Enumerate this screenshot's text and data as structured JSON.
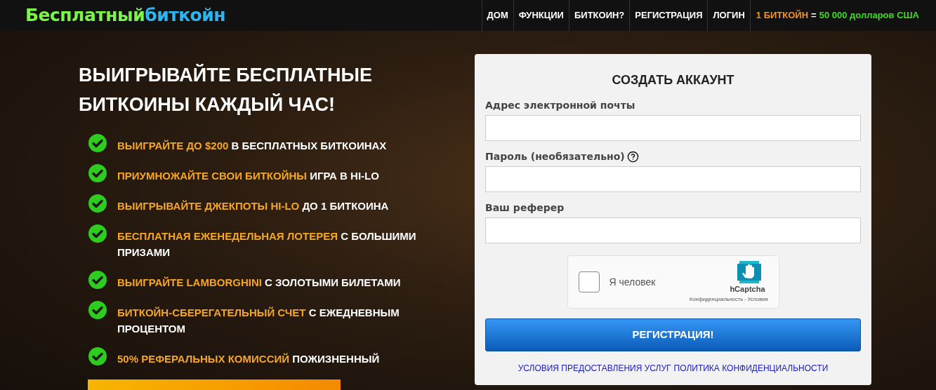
{
  "logo": {
    "part_1": "Бесплатный",
    "part_2": "биткойн"
  },
  "nav": {
    "items": [
      {
        "label": "ДОМ"
      },
      {
        "label": "ФУНКЦИИ"
      },
      {
        "label": "БИТКОИН?"
      },
      {
        "label": "РЕГИСТРАЦИЯ"
      },
      {
        "label": "ЛОГИН"
      }
    ],
    "price": {
      "unit": "1 БИТКОЙН",
      "equals": "=",
      "value": "50 000 долларов США"
    }
  },
  "hero": {
    "headline": "ВЫИГРЫВАЙТЕ БЕСПЛАТНЫЕ БИТКОИНЫ КАЖДЫЙ ЧАС!",
    "features": [
      {
        "highlight": "ВЫИГРАЙТЕ ДО $200",
        "text": "В БЕСПЛАТНЫХ БИТКОИНАХ"
      },
      {
        "highlight": "ПРИУМНОЖАЙТЕ СВОИ БИТКОЙНЫ",
        "text": "ИГРА В HI-LO"
      },
      {
        "highlight": "ВЫИГРЫВАЙТЕ ДЖЕКПОТЫ HI-LO",
        "text": "ДО 1 БИТКОИНА"
      },
      {
        "highlight": "БЕСПЛАТНАЯ ЕЖЕНЕДЕЛЬНАЯ ЛОТЕРЕЯ",
        "text": "С БОЛЬШИМИ ПРИЗАМИ"
      },
      {
        "highlight": "ВЫИГРАЙТЕ LAMBORGHINI",
        "text": "С ЗОЛОТЫМИ БИЛЕТАМИ"
      },
      {
        "highlight": "БИТКОЙН-СБЕРЕГАТЕЛЬНЫЙ СЧЕТ",
        "text": "С ЕЖЕДНЕВНЫМ ПРОЦЕНТОМ"
      },
      {
        "highlight": "50% РЕФЕРАЛЬНЫХ КОМИССИЙ",
        "text": "ПОЖИЗНЕННЫЙ"
      }
    ]
  },
  "form": {
    "title": "СОЗДАТЬ АККАУНТ",
    "fields": [
      {
        "label": "Адрес электронной почты",
        "help": false
      },
      {
        "label": "Пароль (необязательно)",
        "help": true
      },
      {
        "label": "Ваш реферер",
        "help": false
      }
    ],
    "captcha": {
      "label": "Я человек",
      "checked": false,
      "brand": "hCaptcha",
      "privacy": "Конфиденциальность",
      "separator": "-",
      "terms": "Условия"
    },
    "submit": "РЕГИСТРАЦИЯ!",
    "links": [
      "УСЛОВИЯ ПРЕДОСТАВЛЕНИЯ УСЛУГ",
      "ПОЛИТИКА КОНФИДЕНЦИАЛЬНОСТИ"
    ]
  }
}
